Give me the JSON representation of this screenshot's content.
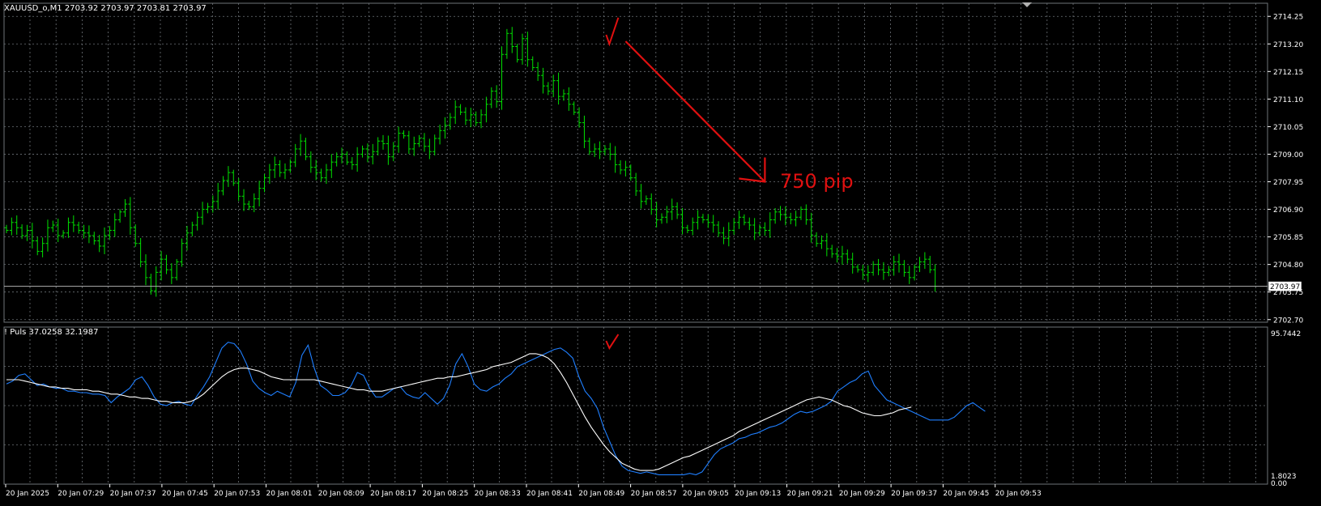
{
  "main_panel": {
    "header": "XAUUSD_o,M1  2703.92 2703.97 2703.81 2703.97",
    "price_labels": [
      "2714.25",
      "2713.20",
      "2712.15",
      "2711.10",
      "2710.05",
      "2709.00",
      "2707.95",
      "2706.90",
      "2705.85",
      "2704.80",
      "2703.75",
      "2702.70"
    ],
    "current_price": "2703.97",
    "annotation": "750 pip"
  },
  "indicator_panel": {
    "header": "! Puls 37.0258 32.1987",
    "max_label": "95.7442",
    "min_label": "1.8023",
    "zero_label": "0.00"
  },
  "time_labels": [
    "20 Jan 2025",
    "20 Jan 07:29",
    "20 Jan 07:37",
    "20 Jan 07:45",
    "20 Jan 07:53",
    "20 Jan 08:01",
    "20 Jan 08:09",
    "20 Jan 08:17",
    "20 Jan 08:25",
    "20 Jan 08:33",
    "20 Jan 08:41",
    "20 Jan 08:49",
    "20 Jan 08:57",
    "20 Jan 09:05",
    "20 Jan 09:13",
    "20 Jan 09:21",
    "20 Jan 09:29",
    "20 Jan 09:37",
    "20 Jan 09:45",
    "20 Jan 09:53"
  ],
  "colors": {
    "background": "#000000",
    "grid": "#6e7378",
    "bar": "#00e000",
    "fast_line": "#1f7fff",
    "slow_line": "#ffffff",
    "annotation": "#e01010",
    "text": "#ffffff"
  },
  "chart_data": [
    {
      "type": "ohlc",
      "series": [
        {
          "name": "XAUUSD_o,M1",
          "close": [
            2706.1,
            2706.4,
            2706.2,
            2705.9,
            2706.1,
            2705.7,
            2705.3,
            2705.6,
            2706.2,
            2706.3,
            2705.9,
            2706.0,
            2706.4,
            2706.3,
            2706.1,
            2706.0,
            2705.9,
            2705.7,
            2705.5,
            2705.9,
            2706.1,
            2706.5,
            2706.8,
            2707.1,
            2706.2,
            2705.6,
            2704.9,
            2704.3,
            2703.8,
            2704.5,
            2705.0,
            2704.6,
            2704.3,
            2704.9,
            2705.6,
            2706.0,
            2706.3,
            2706.6,
            2706.9,
            2707.0,
            2707.2,
            2707.6,
            2708.0,
            2708.3,
            2707.9,
            2707.4,
            2707.1,
            2707.0,
            2707.3,
            2707.7,
            2708.1,
            2708.4,
            2708.6,
            2708.3,
            2708.4,
            2708.7,
            2709.2,
            2709.5,
            2708.9,
            2708.5,
            2708.3,
            2708.1,
            2708.4,
            2708.7,
            2708.9,
            2709.0,
            2708.7,
            2708.6,
            2709.0,
            2709.2,
            2708.9,
            2709.1,
            2709.5,
            2709.4,
            2708.9,
            2709.3,
            2709.8,
            2709.7,
            2709.2,
            2709.4,
            2709.6,
            2709.3,
            2709.1,
            2709.6,
            2709.9,
            2710.1,
            2710.4,
            2710.8,
            2710.6,
            2710.3,
            2710.5,
            2710.2,
            2710.5,
            2710.9,
            2711.4,
            2711.0,
            2712.8,
            2713.6,
            2713.1,
            2712.6,
            2713.4,
            2712.6,
            2712.3,
            2712.0,
            2711.6,
            2711.4,
            2711.8,
            2711.2,
            2711.3,
            2710.9,
            2710.6,
            2710.2,
            2709.5,
            2709.1,
            2709.2,
            2709.1,
            2709.2,
            2709.0,
            2708.6,
            2708.4,
            2708.5,
            2708.1,
            2707.6,
            2707.2,
            2707.3,
            2706.9,
            2706.5,
            2706.6,
            2706.8,
            2707.0,
            2706.7,
            2706.2,
            2706.1,
            2706.4,
            2706.6,
            2706.5,
            2706.4,
            2706.3,
            2706.0,
            2705.8,
            2706.1,
            2706.4,
            2706.6,
            2706.4,
            2706.3,
            2706.0,
            2706.2,
            2706.1,
            2706.5,
            2706.8,
            2706.7,
            2706.6,
            2706.5,
            2706.6,
            2706.9,
            2706.5,
            2705.9,
            2705.6,
            2705.7,
            2705.4,
            2705.2,
            2705.1,
            2705.2,
            2705.0,
            2704.7,
            2704.6,
            2704.4,
            2704.5,
            2704.8,
            2704.6,
            2704.5,
            2704.6,
            2704.9,
            2704.8,
            2704.5,
            2704.3,
            2704.7,
            2704.9,
            2705.0,
            2704.6,
            2703.97
          ]
        }
      ],
      "x_labels": [
        "20 Jan 2025",
        "20 Jan 07:29",
        "20 Jan 07:37",
        "20 Jan 07:45",
        "20 Jan 07:53",
        "20 Jan 08:01",
        "20 Jan 08:09",
        "20 Jan 08:17",
        "20 Jan 08:25",
        "20 Jan 08:33",
        "20 Jan 08:41",
        "20 Jan 08:49",
        "20 Jan 08:57",
        "20 Jan 09:05",
        "20 Jan 09:13",
        "20 Jan 09:21",
        "20 Jan 09:29",
        "20 Jan 09:37",
        "20 Jan 09:45",
        "20 Jan 09:53"
      ],
      "ylim": [
        2702.6,
        2714.75
      ],
      "grid": true,
      "last_value": 2703.97,
      "annotation": {
        "text": "750 pip",
        "arrow_from": {
          "bar": 120,
          "price": 2713.3
        },
        "arrow_to": {
          "bar": 147,
          "price": 2707.95
        }
      }
    },
    {
      "type": "line",
      "series": [
        {
          "name": "fast",
          "values": [
            65,
            67,
            71,
            72,
            68,
            64,
            65,
            63,
            62,
            62,
            60,
            60,
            59,
            59,
            58,
            58,
            57,
            52,
            56,
            59,
            62,
            68,
            70,
            64,
            56,
            51,
            50,
            52,
            53,
            51,
            50,
            57,
            63,
            70,
            80,
            90,
            94,
            93,
            88,
            79,
            67,
            62,
            59,
            57,
            60,
            58,
            56,
            66,
            85,
            92,
            76,
            64,
            61,
            57,
            57,
            59,
            64,
            73,
            71,
            62,
            56,
            56,
            59,
            62,
            63,
            58,
            56,
            55,
            59,
            55,
            51,
            55,
            64,
            79,
            86,
            77,
            65,
            61,
            60,
            63,
            65,
            69,
            72,
            77,
            79,
            81,
            83,
            85,
            87,
            89,
            90,
            87,
            83,
            70,
            60,
            55,
            48,
            35,
            25,
            15,
            8,
            5,
            4,
            3,
            4,
            3,
            2,
            2,
            2,
            2,
            2,
            3,
            2,
            4,
            10,
            16,
            20,
            22,
            24,
            27,
            28,
            30,
            31,
            33,
            35,
            36,
            38,
            41,
            44,
            46,
            45,
            46,
            48,
            50,
            53,
            60,
            63,
            66,
            68,
            72,
            74,
            64,
            59,
            54,
            52,
            50,
            48,
            46,
            44,
            42,
            40,
            40,
            40,
            40,
            42,
            46,
            50,
            52,
            49,
            46
          ],
          "comment_ignore": ""
        },
        {
          "name": "slow",
          "values": [
            68,
            68,
            68,
            67,
            66,
            65,
            64,
            63,
            63,
            62,
            62,
            61,
            61,
            61,
            60,
            60,
            59,
            58,
            58,
            57,
            56,
            56,
            55,
            55,
            54,
            53,
            53,
            52,
            52,
            52,
            53,
            55,
            58,
            62,
            66,
            70,
            73,
            75,
            76,
            76,
            75,
            74,
            72,
            70,
            69,
            68,
            68,
            68,
            68,
            68,
            68,
            67,
            66,
            65,
            64,
            63,
            62,
            61,
            61,
            60,
            60,
            60,
            61,
            62,
            63,
            64,
            65,
            66,
            67,
            68,
            69,
            69,
            70,
            70,
            71,
            72,
            73,
            74,
            75,
            77,
            78,
            79,
            80,
            82,
            84,
            86,
            86,
            85,
            83,
            79,
            73,
            66,
            58,
            50,
            42,
            35,
            29,
            23,
            18,
            14,
            10,
            8,
            6,
            5,
            5,
            5,
            6,
            8,
            10,
            12,
            14,
            15,
            17,
            19,
            21,
            23,
            25,
            27,
            29,
            32,
            34,
            36,
            38,
            40,
            42,
            44,
            46,
            48,
            50,
            52,
            54,
            55,
            56,
            55,
            54,
            52,
            50,
            49,
            47,
            45,
            44,
            43,
            43,
            44,
            45,
            47,
            48,
            49
          ]
        }
      ],
      "ylim": [
        0,
        100
      ],
      "min_label": 1.8023,
      "max_label": 95.7442,
      "grid": true
    }
  ]
}
